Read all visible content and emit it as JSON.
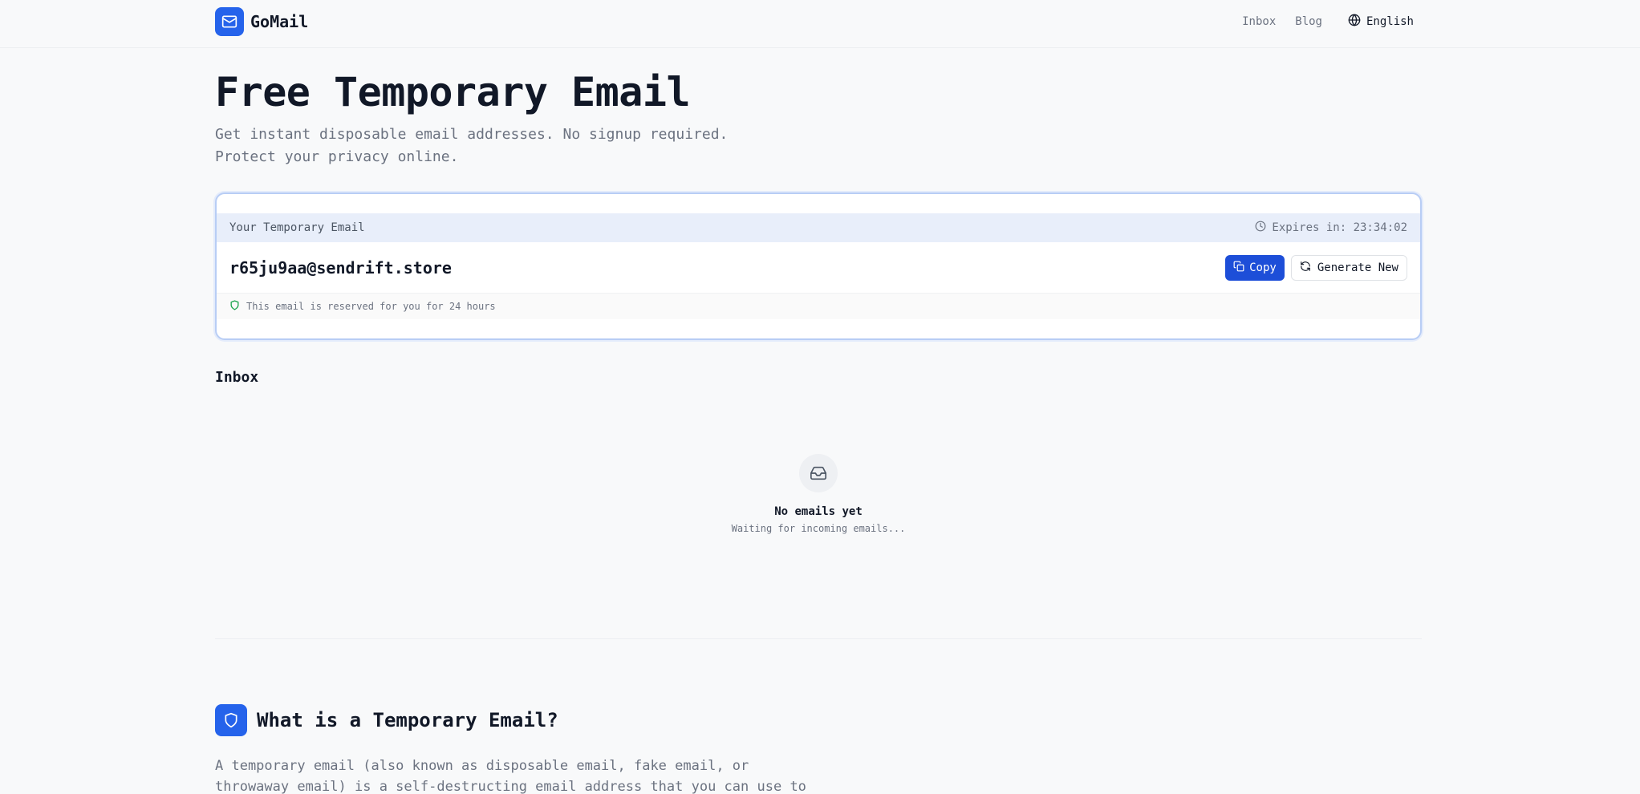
{
  "header": {
    "brand": "GoMail",
    "nav": {
      "inbox": "Inbox",
      "blog": "Blog",
      "language": "English"
    }
  },
  "hero": {
    "title": "Free Temporary Email",
    "subtitle": "Get instant disposable email addresses. No signup required. Protect your privacy online."
  },
  "email_card": {
    "label": "Your Temporary Email",
    "expires": "Expires in: 23:34:02",
    "address": "r65ju9aa@sendrift.store",
    "copy_label": "Copy",
    "generate_label": "Generate New",
    "note": "This email is reserved for you for 24 hours"
  },
  "inbox": {
    "title": "Inbox",
    "empty_title": "No emails yet",
    "empty_subtitle": "Waiting for incoming emails..."
  },
  "about": {
    "title": "What is a Temporary Email?",
    "paragraph": "A temporary email (also known as disposable email, fake email, or throwaway email) is a self-destructing email address that you can use to sign up for"
  },
  "colors": {
    "accent": "#2563eb",
    "button": "#1d4ed8",
    "card_border": "#b8cdf5",
    "card_header": "#e8eefa",
    "shield_green": "#16a34a"
  },
  "icons": {
    "brand": "mail-icon",
    "language": "globe-icon",
    "expires": "clock-icon",
    "copy": "copy-icon",
    "generate": "refresh-icon",
    "note": "shield-icon",
    "empty": "inbox-icon",
    "about": "shield-icon"
  }
}
